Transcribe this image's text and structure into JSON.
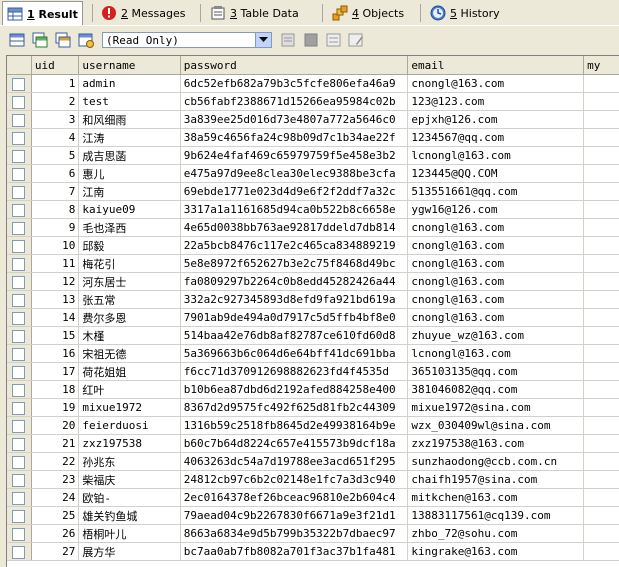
{
  "tabs": [
    {
      "key": "1",
      "label": "Result",
      "icon": "grid-icon"
    },
    {
      "key": "2",
      "label": "Messages",
      "icon": "error-icon"
    },
    {
      "key": "3",
      "label": "Table Data",
      "icon": "table-data-icon"
    },
    {
      "key": "4",
      "label": "Objects",
      "icon": "objects-icon"
    },
    {
      "key": "5",
      "label": "History",
      "icon": "history-icon"
    }
  ],
  "toolbar": {
    "mode_value": "(Read Only)"
  },
  "grid": {
    "columns": [
      "uid",
      "username",
      "password",
      "email",
      "my"
    ],
    "rows": [
      {
        "uid": "1",
        "username": "admin",
        "password": "6dc52efb682a79b3c5fcfe806efa46a9",
        "email": "cnongl@163.com"
      },
      {
        "uid": "2",
        "username": "test",
        "password": "cb56fabf2388671d15266ea95984c02b",
        "email": "123@123.com"
      },
      {
        "uid": "3",
        "username": "和风细雨",
        "password": "3a839ee25d016d73e4807a772a5646c0",
        "email": "epjxh@126.com"
      },
      {
        "uid": "4",
        "username": "江涛",
        "password": "38a59c4656fa24c98b09d7c1b34ae22f",
        "email": "1234567@qq.com"
      },
      {
        "uid": "5",
        "username": "成吉思菡",
        "password": "9b624e4faf469c65979759f5e458e3b2",
        "email": "lcnongl@163.com"
      },
      {
        "uid": "6",
        "username": "惠儿",
        "password": "e475a97d9ee8clea30elec9388be3cfa",
        "email": "123445@QQ.COM"
      },
      {
        "uid": "7",
        "username": "江南",
        "password": "69ebde1771e023d4d9e6f2f2ddf7a32c",
        "email": "513551661@qq.com"
      },
      {
        "uid": "8",
        "username": "kaiyue09",
        "password": "3317a1a1161685d94ca0b522b8c6658e",
        "email": "ygw16@126.com"
      },
      {
        "uid": "9",
        "username": "毛也泽西",
        "password": "4e65d0038bb763ae92817ddeld7db814",
        "email": "cnongl@163.com"
      },
      {
        "uid": "10",
        "username": "邱毅",
        "password": "22a5bcb8476c117e2c465ca834889219",
        "email": "cnongl@163.com"
      },
      {
        "uid": "11",
        "username": "梅花引",
        "password": "5e8e8972f652627b3e2c75f8468d49bc",
        "email": "cnongl@163.com"
      },
      {
        "uid": "12",
        "username": "河东居士",
        "password": "fa0809297b2264c0b8edd45282426a44",
        "email": "cnongl@163.com"
      },
      {
        "uid": "13",
        "username": "张五常",
        "password": "332a2c927345893d8efd9fa921bd619a",
        "email": "cnongl@163.com"
      },
      {
        "uid": "14",
        "username": "费尔多恩",
        "password": "7901ab9de494a0d7917c5d5ffb4bf8e0",
        "email": "cnongl@163.com"
      },
      {
        "uid": "15",
        "username": "木槿",
        "password": "514baa42e76db8af82787ce610fd60d8",
        "email": "zhuyue_wz@163.com"
      },
      {
        "uid": "16",
        "username": "宋祖无德",
        "password": "5a369663b6c064d6e64bff41dc691bba",
        "email": "lcnongl@163.com"
      },
      {
        "uid": "17",
        "username": "荷花姐姐",
        "password": "f6cc71d370912698882623fd4f4535d",
        "email": "365103135@qq.com"
      },
      {
        "uid": "18",
        "username": "红叶",
        "password": "b10b6ea87dbd6d2192afed884258e400",
        "email": "381046082@qq.com"
      },
      {
        "uid": "19",
        "username": "mixue1972",
        "password": "8367d2d9575fc492f625d81fb2c44309",
        "email": "mixue1972@sina.com"
      },
      {
        "uid": "20",
        "username": "feierduosi",
        "password": "1316b59c2518fb8645d2e49938164b9e",
        "email": "wzx_030409wl@sina.com"
      },
      {
        "uid": "21",
        "username": "zxz197538",
        "password": "b60c7b64d8224c657e415573b9dcf18a",
        "email": "zxz197538@163.com"
      },
      {
        "uid": "22",
        "username": "孙兆东",
        "password": "4063263dc54a7d19788ee3acd651f295",
        "email": "sunzhaodong@ccb.com.cn"
      },
      {
        "uid": "23",
        "username": "柴福庆",
        "password": "24812cb97c6b2c02148e1fc7a3d3c940",
        "email": "chaifh1957@sina.com"
      },
      {
        "uid": "24",
        "username": "欧铂-",
        "password": "2ec0164378ef26bceac96810e2b604c4",
        "email": "mitkchen@163.com"
      },
      {
        "uid": "25",
        "username": "雄关钓鱼城",
        "password": "79aead04c9b2267830f6671a9e3f21d1",
        "email": "13883117561@cq139.com"
      },
      {
        "uid": "26",
        "username": "梧桐叶儿",
        "password": "8663a6834e9d5b799b35322b7dbaec97",
        "email": "zhbo_72@sohu.com"
      },
      {
        "uid": "27",
        "username": "展方华",
        "password": "bc7aa0ab7fb8082a701f3ac37b1fa481",
        "email": "kingrake@163.com"
      }
    ]
  }
}
